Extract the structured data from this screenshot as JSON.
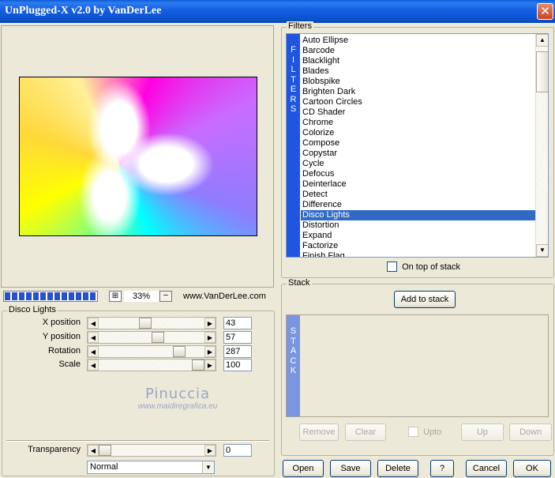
{
  "window": {
    "title": "UnPlugged-X v2.0 by VanDerLee",
    "close_glyph": "✕"
  },
  "preview": {
    "zoom": "33%",
    "zoom_icon": "⊞",
    "zoom_minus": "−",
    "website": "www.VanDerLee.com",
    "progress_blocks": 13
  },
  "params": {
    "group_label": "Disco Lights",
    "rows": [
      {
        "label": "X position",
        "value": "43",
        "level": 0.43
      },
      {
        "label": "Y position",
        "value": "57",
        "level": 0.57
      },
      {
        "label": "Rotation",
        "value": "287",
        "level": 0.8
      },
      {
        "label": "Scale",
        "value": "100",
        "level": 1.0
      }
    ]
  },
  "watermark": {
    "name": "Pinuccia",
    "url": "www.maidiregrafica.eu"
  },
  "transparency": {
    "label": "Transparency",
    "value": "0",
    "level": 0.0
  },
  "blend_mode": {
    "selected": "Normal"
  },
  "filters": {
    "group_label": "Filters",
    "tab_letters": [
      "F",
      "I",
      "L",
      "T",
      "E",
      "R",
      "S"
    ],
    "items": [
      "Auto Ellipse",
      "Barcode",
      "Blacklight",
      "Blades",
      "Blobspike",
      "Brighten Dark",
      "Cartoon Circles",
      "CD Shader",
      "Chrome",
      "Colorize",
      "Compose",
      "Copystar",
      "Cycle",
      "Defocus",
      "Deinterlace",
      "Detect",
      "Difference",
      "Disco Lights",
      "Distortion",
      "Expand",
      "Factorize",
      "Finish Flag"
    ],
    "selected": "Disco Lights",
    "on_top_label": "On top of stack"
  },
  "stack": {
    "group_label": "Stack",
    "add_label": "Add to stack",
    "tab_letters": [
      "S",
      "T",
      "A",
      "C",
      "K"
    ],
    "remove_label": "Remove",
    "clear_label": "Clear",
    "upto_label": "Upto",
    "up_label": "Up",
    "down_label": "Down"
  },
  "footer": {
    "open": "Open",
    "save": "Save",
    "delete": "Delete",
    "help": "?",
    "cancel": "Cancel",
    "ok": "OK"
  },
  "colors": {
    "title_bar": "#0a4fc9",
    "accent": "#316ac5",
    "filters_tab": "#1f55e0",
    "stack_tab": "#7b96e0",
    "background": "#ece9d8"
  }
}
